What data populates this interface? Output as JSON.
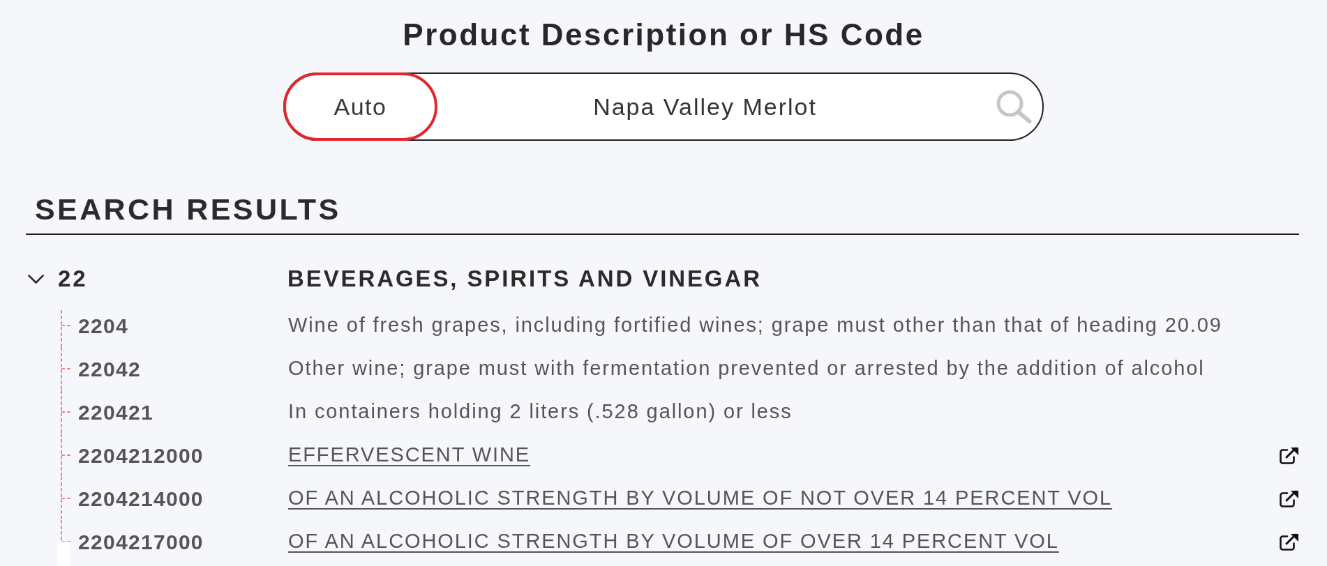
{
  "title": "Product Description or HS Code",
  "search": {
    "mode_button": "Auto",
    "value": "Napa Valley Merlot"
  },
  "results": {
    "heading": "SEARCH RESULTS",
    "groups": [
      {
        "code": "22",
        "description": "BEVERAGES, SPIRITS AND VINEGAR",
        "expanded": true,
        "children": [
          {
            "code": "2204",
            "description": "Wine of fresh grapes, including fortified wines; grape must other than that of heading 20.09",
            "kind": "text"
          },
          {
            "code": "22042",
            "description": "Other wine; grape must with fermentation prevented or arrested by the addition of alcohol",
            "kind": "text"
          },
          {
            "code": "220421",
            "description": "In containers holding 2 liters (.528 gallon) or less",
            "kind": "text"
          },
          {
            "code": "2204212000",
            "description": "EFFERVESCENT WINE",
            "kind": "link"
          },
          {
            "code": "2204214000",
            "description": "OF AN ALCOHOLIC STRENGTH BY VOLUME OF NOT OVER 14 PERCENT VOL",
            "kind": "link"
          },
          {
            "code": "2204217000",
            "description": "OF AN ALCOHOLIC STRENGTH BY VOLUME OF OVER 14 PERCENT VOL",
            "kind": "link"
          }
        ]
      }
    ]
  }
}
